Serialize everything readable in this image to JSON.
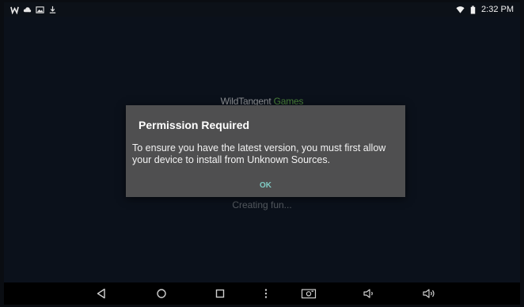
{
  "status_bar": {
    "left_icons": [
      "wildtangent-w-icon",
      "cloud-icon",
      "gallery-icon",
      "download-icon"
    ],
    "right_icons": [
      "wifi-icon",
      "battery-icon"
    ],
    "time": "2:32 PM"
  },
  "app": {
    "brand_part1": "WildTangent",
    "brand_part2": "Games",
    "loading_text": "Creating fun..."
  },
  "dialog": {
    "title": "Permission Required",
    "message": "To ensure you have the latest version, you must first allow your device to install from Unknown Sources.",
    "ok_label": "OK"
  },
  "navbar": {
    "buttons": [
      "back-icon",
      "home-icon",
      "recents-icon",
      "menu-icon",
      "screenshot-icon",
      "volume-down-icon",
      "volume-up-icon"
    ]
  },
  "colors": {
    "background": "#0f1723",
    "dialog": "#4f4f50",
    "accent": "#80cbc4",
    "brand_green": "#5ea34a"
  }
}
